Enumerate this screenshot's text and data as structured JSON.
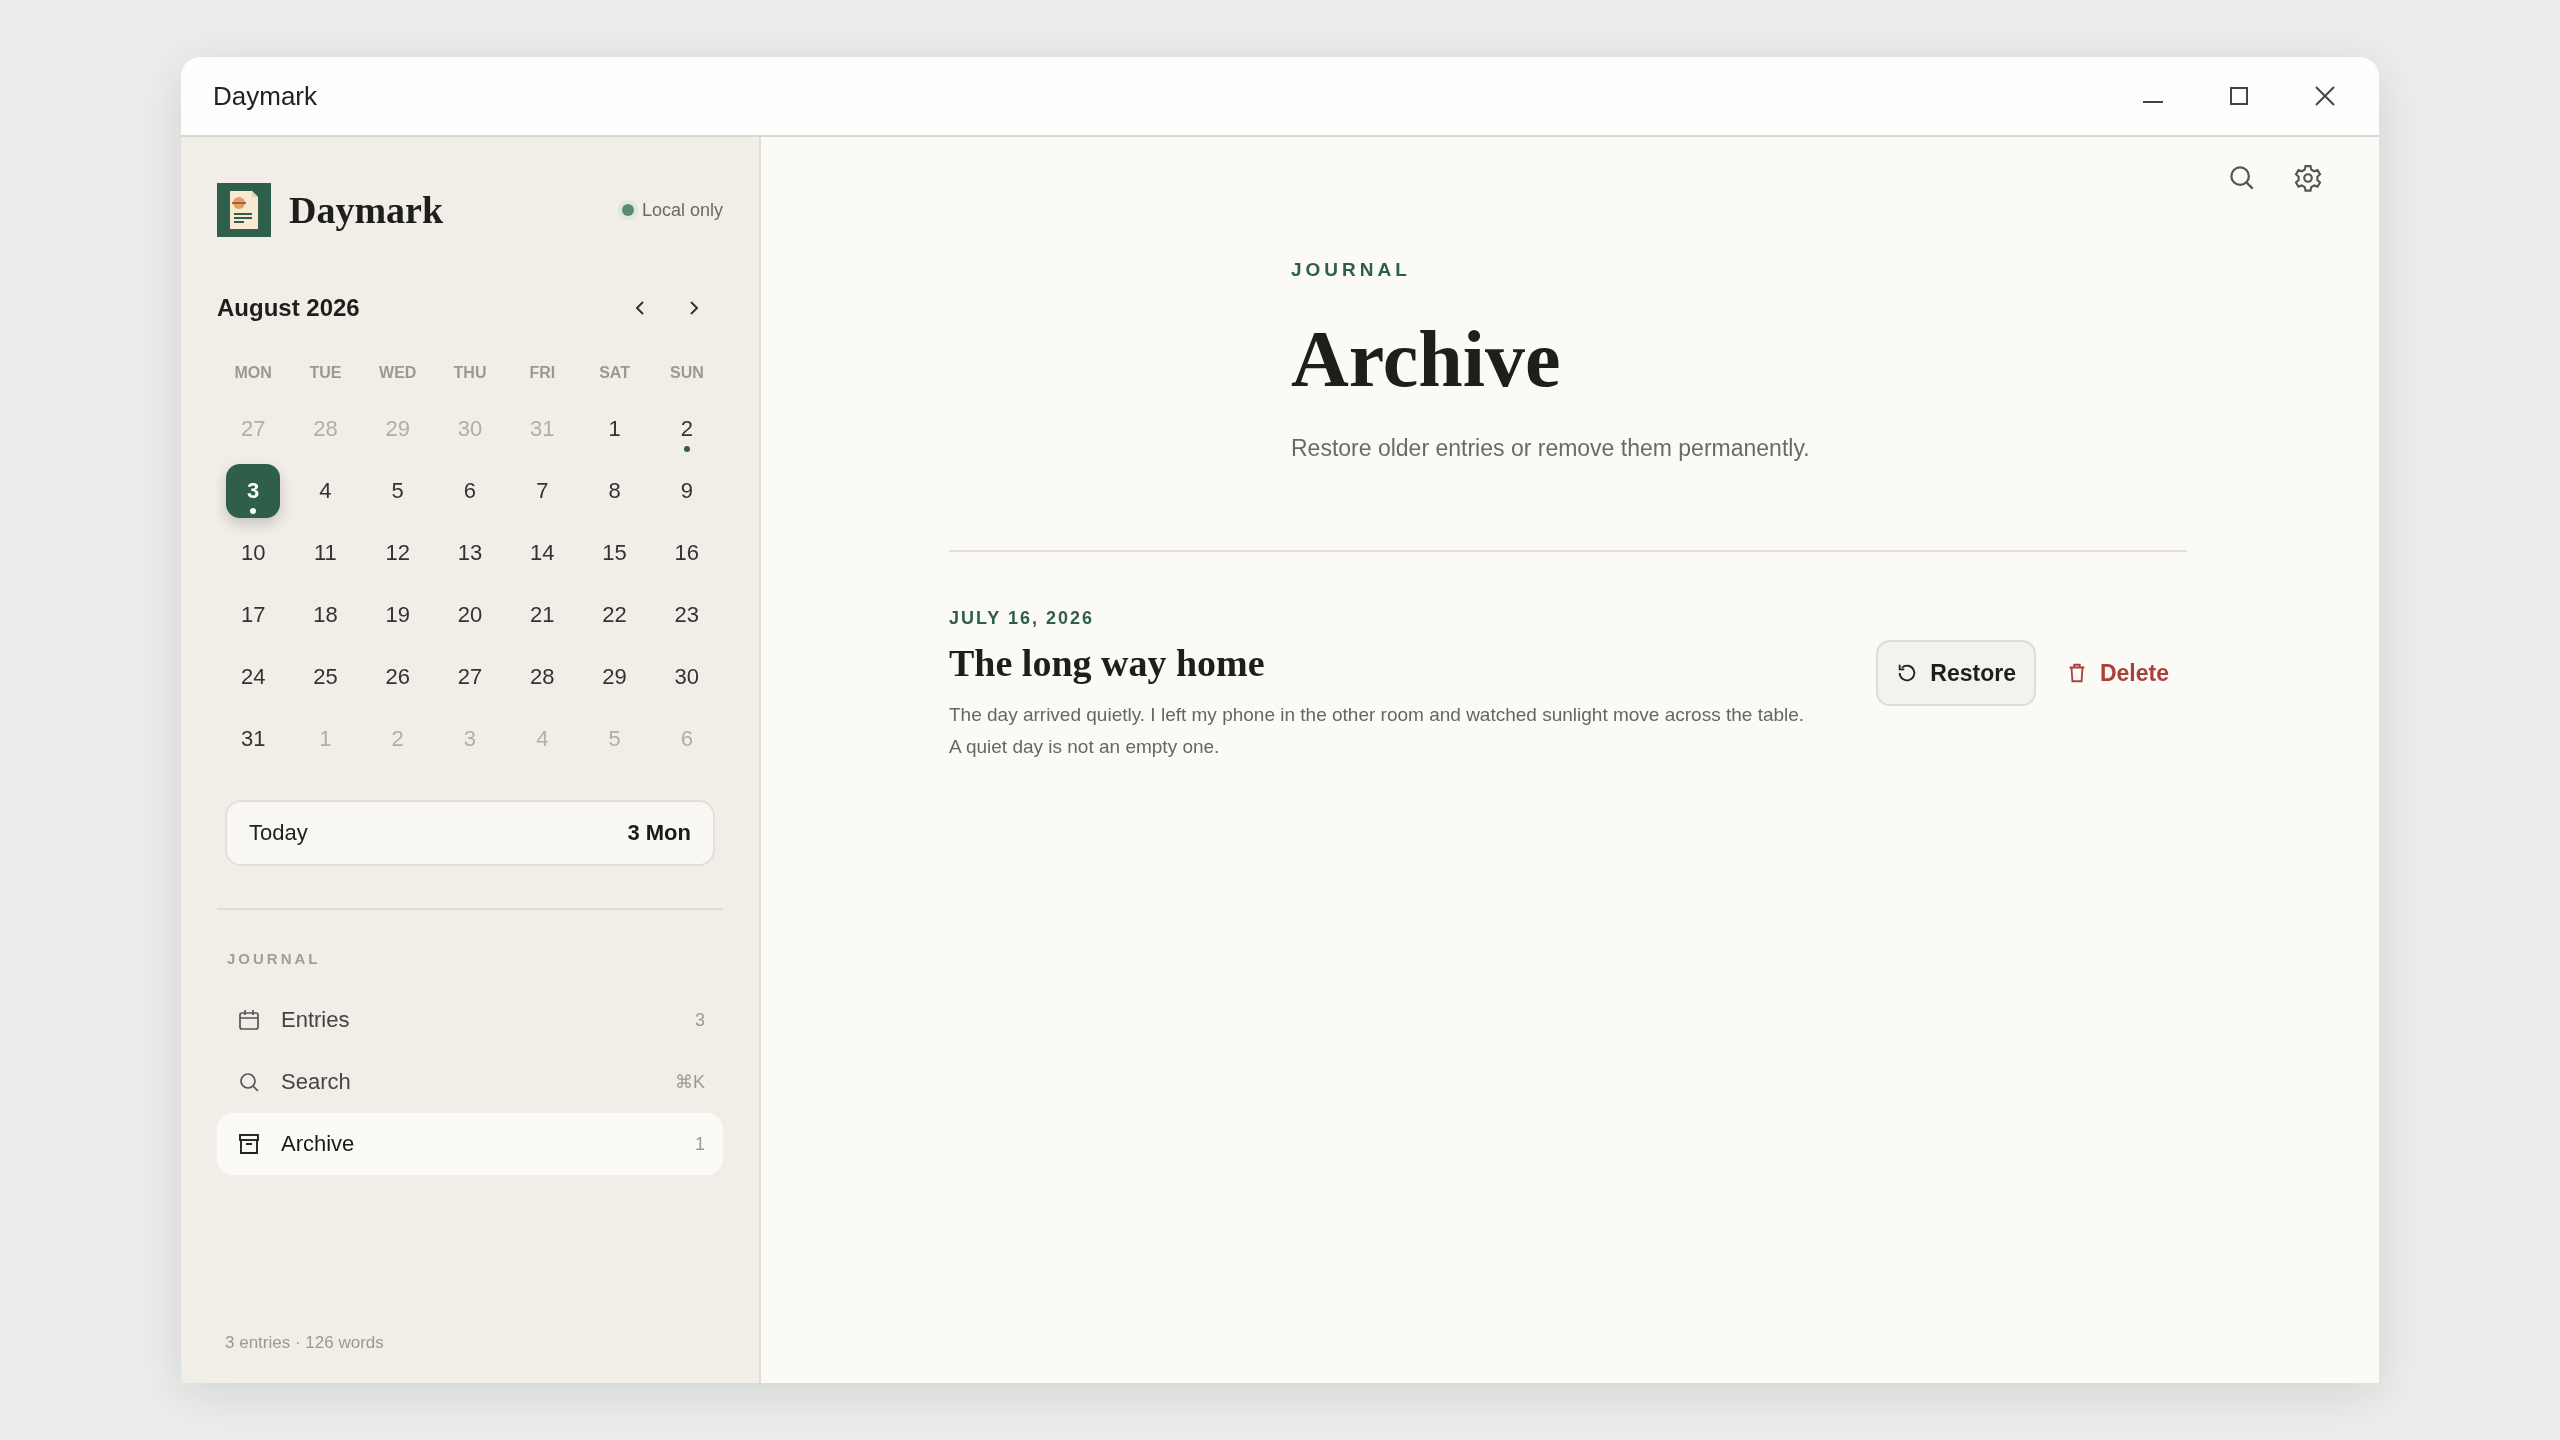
{
  "window": {
    "title": "Daymark"
  },
  "sidebar": {
    "app_name": "Daymark",
    "sync_status": "Local only",
    "calendar": {
      "month": "August 2026",
      "weekdays": [
        "MON",
        "TUE",
        "WED",
        "THU",
        "FRI",
        "SAT",
        "SUN"
      ],
      "days": [
        {
          "label": "27",
          "outside": true,
          "selected": false,
          "has_entry": false
        },
        {
          "label": "28",
          "outside": true,
          "selected": false,
          "has_entry": false
        },
        {
          "label": "29",
          "outside": true,
          "selected": false,
          "has_entry": false
        },
        {
          "label": "30",
          "outside": true,
          "selected": false,
          "has_entry": false
        },
        {
          "label": "31",
          "outside": true,
          "selected": false,
          "has_entry": false
        },
        {
          "label": "1",
          "outside": false,
          "selected": false,
          "has_entry": false
        },
        {
          "label": "2",
          "outside": false,
          "selected": false,
          "has_entry": true
        },
        {
          "label": "3",
          "outside": false,
          "selected": true,
          "has_entry": true
        },
        {
          "label": "4",
          "outside": false,
          "selected": false,
          "has_entry": false
        },
        {
          "label": "5",
          "outside": false,
          "selected": false,
          "has_entry": false
        },
        {
          "label": "6",
          "outside": false,
          "selected": false,
          "has_entry": false
        },
        {
          "label": "7",
          "outside": false,
          "selected": false,
          "has_entry": false
        },
        {
          "label": "8",
          "outside": false,
          "selected": false,
          "has_entry": false
        },
        {
          "label": "9",
          "outside": false,
          "selected": false,
          "has_entry": false
        },
        {
          "label": "10",
          "outside": false,
          "selected": false,
          "has_entry": false
        },
        {
          "label": "11",
          "outside": false,
          "selected": false,
          "has_entry": false
        },
        {
          "label": "12",
          "outside": false,
          "selected": false,
          "has_entry": false
        },
        {
          "label": "13",
          "outside": false,
          "selected": false,
          "has_entry": false
        },
        {
          "label": "14",
          "outside": false,
          "selected": false,
          "has_entry": false
        },
        {
          "label": "15",
          "outside": false,
          "selected": false,
          "has_entry": false
        },
        {
          "label": "16",
          "outside": false,
          "selected": false,
          "has_entry": false
        },
        {
          "label": "17",
          "outside": false,
          "selected": false,
          "has_entry": false
        },
        {
          "label": "18",
          "outside": false,
          "selected": false,
          "has_entry": false
        },
        {
          "label": "19",
          "outside": false,
          "selected": false,
          "has_entry": false
        },
        {
          "label": "20",
          "outside": false,
          "selected": false,
          "has_entry": false
        },
        {
          "label": "21",
          "outside": false,
          "selected": false,
          "has_entry": false
        },
        {
          "label": "22",
          "outside": false,
          "selected": false,
          "has_entry": false
        },
        {
          "label": "23",
          "outside": false,
          "selected": false,
          "has_entry": false
        },
        {
          "label": "24",
          "outside": false,
          "selected": false,
          "has_entry": false
        },
        {
          "label": "25",
          "outside": false,
          "selected": false,
          "has_entry": false
        },
        {
          "label": "26",
          "outside": false,
          "selected": false,
          "has_entry": false
        },
        {
          "label": "27",
          "outside": false,
          "selected": false,
          "has_entry": false
        },
        {
          "label": "28",
          "outside": false,
          "selected": false,
          "has_entry": false
        },
        {
          "label": "29",
          "outside": false,
          "selected": false,
          "has_entry": false
        },
        {
          "label": "30",
          "outside": false,
          "selected": false,
          "has_entry": false
        },
        {
          "label": "31",
          "outside": false,
          "selected": false,
          "has_entry": false
        },
        {
          "label": "1",
          "outside": true,
          "selected": false,
          "has_entry": false
        },
        {
          "label": "2",
          "outside": true,
          "selected": false,
          "has_entry": false
        },
        {
          "label": "3",
          "outside": true,
          "selected": false,
          "has_entry": false
        },
        {
          "label": "4",
          "outside": true,
          "selected": false,
          "has_entry": false
        },
        {
          "label": "5",
          "outside": true,
          "selected": false,
          "has_entry": false
        },
        {
          "label": "6",
          "outside": true,
          "selected": false,
          "has_entry": false
        }
      ]
    },
    "today": {
      "label": "Today",
      "value": "3 Mon"
    },
    "section_label": "JOURNAL",
    "nav": [
      {
        "kind": "calendar",
        "label": "Entries",
        "hint": "3",
        "selected": false
      },
      {
        "kind": "search",
        "label": "Search",
        "hint": "⌘K",
        "selected": false
      },
      {
        "kind": "archive",
        "label": "Archive",
        "hint": "1",
        "selected": true
      }
    ],
    "footer": "3 entries · 126 words"
  },
  "main": {
    "eyebrow": "JOURNAL",
    "title": "Archive",
    "subtitle": "Restore older entries or remove them permanently.",
    "entries": [
      {
        "date": "JULY 16, 2026",
        "title": "The long way home",
        "excerpt": "The day arrived quietly. I left my phone in the other room and watched sunlight move across the table. A quiet day is not an empty one.",
        "actions": [
          "Restore",
          "Delete"
        ]
      }
    ]
  }
}
